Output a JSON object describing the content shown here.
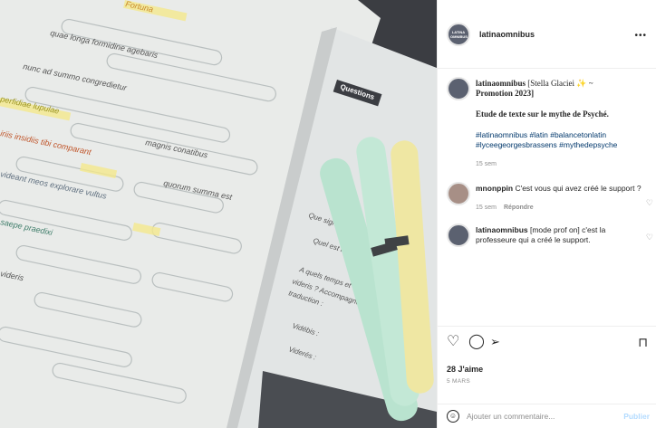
{
  "post": {
    "username": "latinaomnibus",
    "more_icon": "more-horizontal-icon",
    "avatar_text": "LATINA OMNIBUS"
  },
  "caption": {
    "username": "latinaomnibus",
    "line1": " [Stella Glaciei ✨ ~",
    "line2": "Promotion 2023]",
    "body": "Etude de texte sur le mythe de Psyché.",
    "hashtags": "#latinaomnibus #latin #balancetonlatin #lyceegeorgesbrassens #mythedepsyche",
    "time": "15 sem"
  },
  "comments": [
    {
      "username": "mnonppin",
      "text": " C'est vous qui avez créé le support ?",
      "time": "15 sem",
      "reply": "Répondre"
    },
    {
      "username": "latinaomnibus",
      "text": " [mode prof on] c'est la professeure qui a créé le support."
    }
  ],
  "actions": {
    "like_icon": "heart-icon",
    "comment_icon": "comment-icon",
    "share_icon": "send-icon",
    "save_icon": "bookmark-icon",
    "likes": "28 J'aime",
    "date": "5 MARS"
  },
  "add_comment": {
    "placeholder": "Ajouter un commentaire...",
    "publish": "Publier",
    "emoji_icon": "emoji-icon"
  },
  "photo": {
    "labels": [
      "Fortuna",
      "quae longa formidine agebaris",
      "nunc ad summo congredietur",
      "perfidiae lupulae",
      "magnis conatibus",
      "iriis insidiis tibi comparant",
      "quorum summa est",
      "videant meos explorare vultus",
      "saepe praedixi",
      "videris",
      "Questions",
      "Quel est l'",
      "Que signi",
      "A quels temps et",
      "videris ? Accompagne",
      "traduction :",
      "Vidébis :",
      "Viderés :"
    ]
  }
}
